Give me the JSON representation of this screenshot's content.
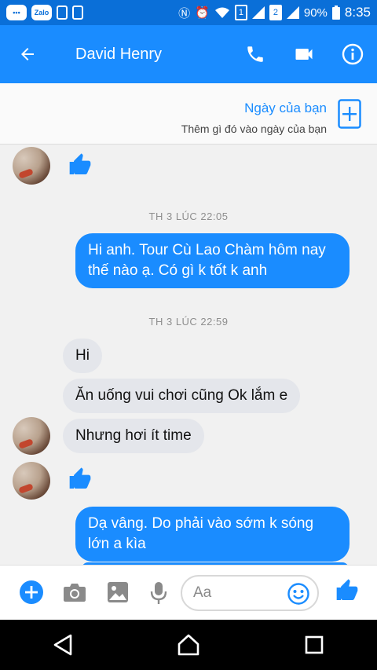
{
  "status_bar": {
    "app_chip_label": "Zalo",
    "sim1": "1",
    "sim2": "2",
    "battery": "90%",
    "time": "8:35"
  },
  "header": {
    "contact_name": "David Henry"
  },
  "day_banner": {
    "title": "Ngày của bạn",
    "subtitle": "Thêm gì đó vào ngày của bạn"
  },
  "conversation": {
    "timestamp_1": "TH 3 LÚC 22:05",
    "msg_out_1": "Hi anh. Tour Cù Lao Chàm hôm nay thế nào ạ. Có gì k tốt k anh",
    "timestamp_2": "TH 3 LÚC 22:59",
    "msg_in_1": "Hi",
    "msg_in_2": "Ăn uống vui chơi cũng Ok lắm e",
    "msg_in_3": "Nhưng hơi ít time",
    "msg_out_2": "Dạ vâng. Do phải vào sớm k sóng lớn a kìa"
  },
  "composer": {
    "placeholder": "Aa"
  },
  "colors": {
    "accent": "#1a8cff",
    "status_bar": "#0a6fd8",
    "incoming_bubble": "#e4e6eb"
  }
}
